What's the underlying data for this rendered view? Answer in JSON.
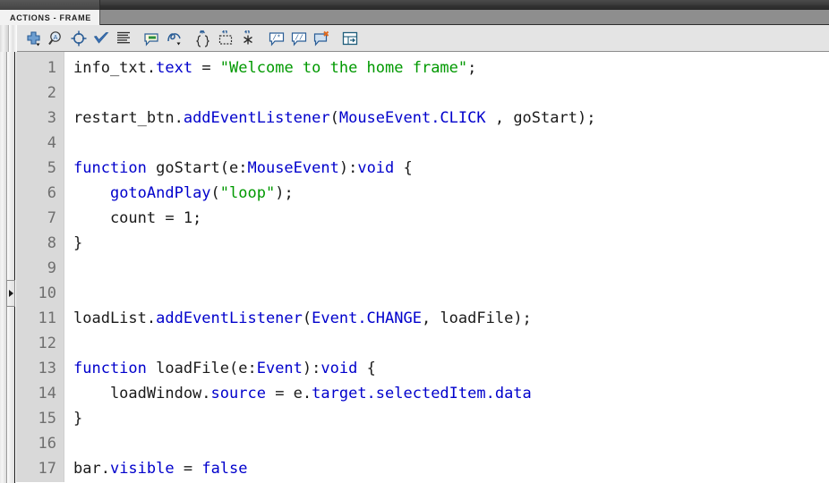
{
  "window": {
    "panel_tab_label": "ACTIONS - FRAME"
  },
  "toolbar": {
    "buttons": [
      {
        "name": "add-statement-icon",
        "title": "Add a new item to the script"
      },
      {
        "name": "find-replace-icon",
        "title": "Find"
      },
      {
        "name": "insert-target-path-icon",
        "title": "Insert target path"
      },
      {
        "name": "check-syntax-icon",
        "title": "Check syntax"
      },
      {
        "name": "auto-format-icon",
        "title": "Auto format"
      },
      {
        "name": "show-code-hint-icon",
        "title": "Show code hint"
      },
      {
        "name": "debug-options-icon",
        "title": "Debug options"
      },
      {
        "name": "collapse-between-braces-icon",
        "title": "Collapse between braces"
      },
      {
        "name": "collapse-selection-icon",
        "title": "Collapse selection"
      },
      {
        "name": "expand-all-icon",
        "title": "Expand all"
      },
      {
        "name": "apply-block-comment-icon",
        "title": "Apply block comment"
      },
      {
        "name": "apply-line-comment-icon",
        "title": "Apply line comment"
      },
      {
        "name": "remove-comment-icon",
        "title": "Remove comment"
      },
      {
        "name": "script-assist-icon",
        "title": "Script Assist"
      }
    ]
  },
  "editor": {
    "line_numbers": [
      1,
      2,
      3,
      4,
      5,
      6,
      7,
      8,
      9,
      10,
      11,
      12,
      13,
      14,
      15,
      16,
      17
    ],
    "lines": [
      {
        "n": 1,
        "tokens": [
          {
            "t": "info_txt.",
            "c": "plain"
          },
          {
            "t": "text",
            "c": "prop"
          },
          {
            "t": " = ",
            "c": "plain"
          },
          {
            "t": "\"Welcome to the home frame\"",
            "c": "str"
          },
          {
            "t": ";",
            "c": "plain"
          }
        ]
      },
      {
        "n": 2,
        "tokens": []
      },
      {
        "n": 3,
        "tokens": [
          {
            "t": "restart_btn.",
            "c": "plain"
          },
          {
            "t": "addEventListener",
            "c": "prop"
          },
          {
            "t": "(",
            "c": "plain"
          },
          {
            "t": "MouseEvent.CLICK",
            "c": "prop"
          },
          {
            "t": " , goStart);",
            "c": "plain"
          }
        ]
      },
      {
        "n": 4,
        "tokens": []
      },
      {
        "n": 5,
        "tokens": [
          {
            "t": "function",
            "c": "kw"
          },
          {
            "t": " goStart(e:",
            "c": "plain"
          },
          {
            "t": "MouseEvent",
            "c": "prop"
          },
          {
            "t": "):",
            "c": "plain"
          },
          {
            "t": "void",
            "c": "kw"
          },
          {
            "t": " {",
            "c": "plain"
          }
        ]
      },
      {
        "n": 6,
        "tokens": [
          {
            "t": "    ",
            "c": "plain"
          },
          {
            "t": "gotoAndPlay",
            "c": "prop"
          },
          {
            "t": "(",
            "c": "plain"
          },
          {
            "t": "\"loop\"",
            "c": "str"
          },
          {
            "t": ");",
            "c": "plain"
          }
        ]
      },
      {
        "n": 7,
        "tokens": [
          {
            "t": "    count = 1;",
            "c": "plain"
          }
        ]
      },
      {
        "n": 8,
        "tokens": [
          {
            "t": "}",
            "c": "plain"
          }
        ]
      },
      {
        "n": 9,
        "tokens": []
      },
      {
        "n": 10,
        "tokens": []
      },
      {
        "n": 11,
        "tokens": [
          {
            "t": "loadList.",
            "c": "plain"
          },
          {
            "t": "addEventListener",
            "c": "prop"
          },
          {
            "t": "(",
            "c": "plain"
          },
          {
            "t": "Event.CHANGE",
            "c": "prop"
          },
          {
            "t": ", loadFile);",
            "c": "plain"
          }
        ]
      },
      {
        "n": 12,
        "tokens": []
      },
      {
        "n": 13,
        "tokens": [
          {
            "t": "function",
            "c": "kw"
          },
          {
            "t": " loadFile(e:",
            "c": "plain"
          },
          {
            "t": "Event",
            "c": "prop"
          },
          {
            "t": "):",
            "c": "plain"
          },
          {
            "t": "void",
            "c": "kw"
          },
          {
            "t": " {",
            "c": "plain"
          }
        ]
      },
      {
        "n": 14,
        "tokens": [
          {
            "t": "    loadWindow.",
            "c": "plain"
          },
          {
            "t": "source",
            "c": "prop"
          },
          {
            "t": " = e.",
            "c": "plain"
          },
          {
            "t": "target.selectedItem.data",
            "c": "prop"
          }
        ]
      },
      {
        "n": 15,
        "tokens": [
          {
            "t": "}",
            "c": "plain"
          }
        ]
      },
      {
        "n": 16,
        "tokens": []
      },
      {
        "n": 17,
        "tokens": [
          {
            "t": "bar.",
            "c": "plain"
          },
          {
            "t": "visible",
            "c": "prop"
          },
          {
            "t": " = ",
            "c": "plain"
          },
          {
            "t": "false",
            "c": "kw"
          }
        ]
      }
    ]
  },
  "colors": {
    "keyword": "#0000cc",
    "property": "#0000cc",
    "string": "#009900",
    "plain": "#1a1a1a",
    "gutter_bg": "#d9d9d9",
    "gutter_text": "#6f6f6f",
    "toolbar_bg": "#e4e4e4",
    "tabbar_bg": "#8e8e8e",
    "titlebar_bg": "#3c3c3c"
  },
  "panel": {
    "collapse_handle_label": "collapse-panel-arrow"
  }
}
